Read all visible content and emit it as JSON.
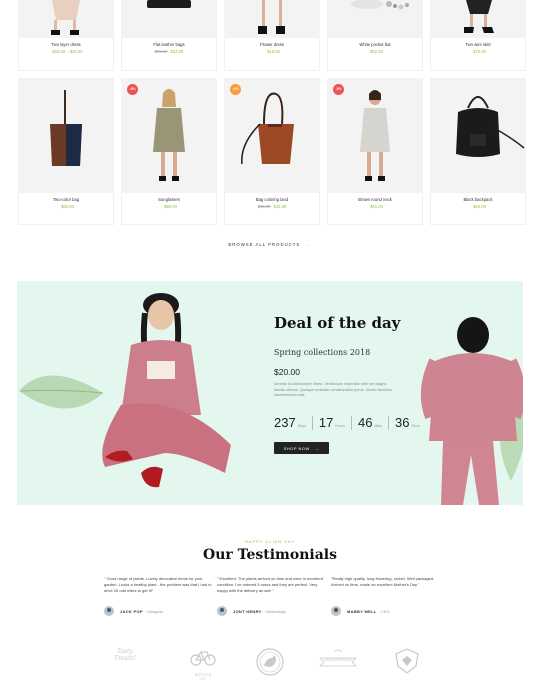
{
  "products_top": [
    {
      "name": "Two layer dress",
      "price": "$15.00 – $20.00",
      "old_price": ""
    },
    {
      "name": "Flat leather bags",
      "price": "$22.00",
      "old_price": "$25.00"
    },
    {
      "name": "Flower dress",
      "price": "$15.00",
      "old_price": ""
    },
    {
      "name": "White pocket bat",
      "price": "$32.00",
      "old_price": ""
    },
    {
      "name": "Two wire skirt",
      "price": "$75.00",
      "old_price": ""
    }
  ],
  "products_mid": [
    {
      "name": "Two-color bag",
      "price": "$30.00",
      "old_price": "",
      "badge": ""
    },
    {
      "name": "Sunglasses",
      "price": "$90.00",
      "old_price": "",
      "badge": "-8%"
    },
    {
      "name": "Bag coloring land",
      "price": "$42.00",
      "old_price": "$45.00",
      "badge": "-4%"
    },
    {
      "name": "Brown round neck",
      "price": "$41.00",
      "old_price": "",
      "badge": "-8%"
    },
    {
      "name": "Black backpack",
      "price": "$44.00",
      "old_price": "",
      "badge": ""
    }
  ],
  "browse": {
    "label": "BROWSE ALL PRODUCTS",
    "arrow": "→"
  },
  "deal": {
    "title": "Deal of the day",
    "subtitle": "Spring collections 2018",
    "price": "$20.00",
    "description": "Aenean id ullamcorper libero. Vestibulum imperdiet nibh vel magna lacinia ultrices. Quisque molestie condimentum purus. Donec faucibus condimentum erat.",
    "countdown": [
      {
        "value": "237",
        "label": "Days"
      },
      {
        "value": "17",
        "label": "Hours"
      },
      {
        "value": "46",
        "label": "Mins"
      },
      {
        "value": "36",
        "label": "Secs"
      }
    ],
    "button": "SHOP NOW",
    "button_arrow": "→"
  },
  "testimonials": {
    "eyebrow": "HAPPY CLIEN SAY",
    "title": "Our Testimonials",
    "items": [
      {
        "quote": "\" Good range of plants. Lovely decorative items for your garden. Looks a healthy plant - the problem was that I had to drive 20 odd miles to get it!\"",
        "name": "JACK POP",
        "role": "- Designer"
      },
      {
        "quote": "\" Excellent. The plants arrived on time and were in excellent condition. I've ordered 5 roses and they are perfect. Very happy with the delivery as well \"",
        "name": "JONT HENRY",
        "role": "- Webdesign"
      },
      {
        "quote": "\"Really high quality, long flowering, orchid. Well packaged. Arrived on time, made an excellent Mother's Day\"",
        "name": "MABBY MELL",
        "role": "- CEO"
      }
    ]
  },
  "logos": [
    {
      "line1": "Tasty",
      "line2": "Treats!"
    },
    {
      "line1": "BICYCLE",
      "line2": "CO"
    },
    {
      "line1": "",
      "line2": ""
    },
    {
      "line1": "Handmade",
      "line2": ""
    },
    {
      "line1": "",
      "line2": ""
    }
  ],
  "colors": {
    "accent": "#8bc34a",
    "deal_bg": "#e3f7ee",
    "sale_badge": "#ef5350",
    "new_badge": "#ff9a3d"
  }
}
